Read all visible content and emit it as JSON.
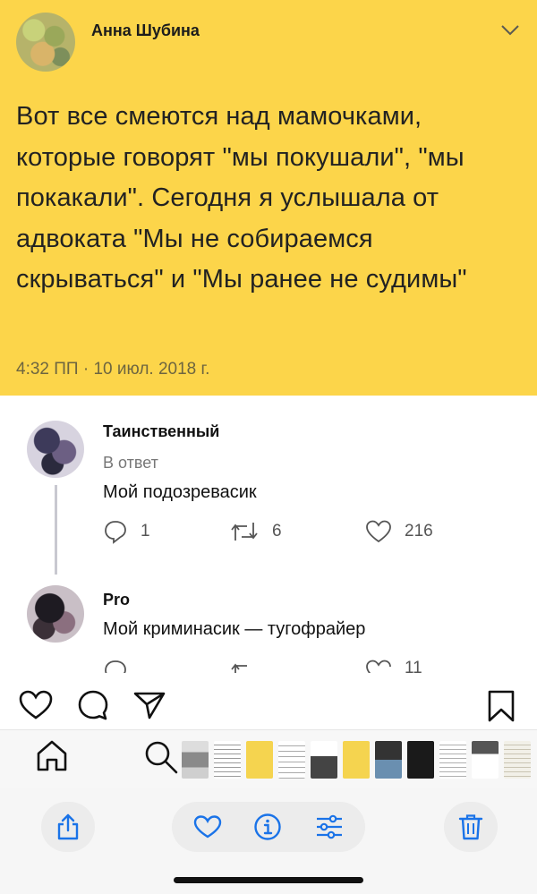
{
  "tweet": {
    "author": "Анна Шубина",
    "text": "Вот все смеются над мамочками, которые говорят \"мы покушали\", \"мы покакали\". Сегодня я услышала от адвоката \"Мы не собираемся скрываться\" и \"Мы ранее не судимы\"",
    "time": "4:32 ПП · 10 июл. 2018 г.",
    "background": "#fcd54a"
  },
  "replies": [
    {
      "name": "Таинственный",
      "meta": "В ответ",
      "text": "Мой подозревасик",
      "replies_count": "1",
      "retweets_count": "6",
      "likes_count": "216"
    },
    {
      "name": "Pro",
      "text": "Мой криминасик — тугофрайер",
      "likes_count": "11"
    }
  ],
  "toolbar": {
    "accent": "#1a73e8",
    "icons": [
      "share-icon",
      "heart-icon",
      "info-icon",
      "adjust-icon",
      "trash-icon"
    ]
  }
}
